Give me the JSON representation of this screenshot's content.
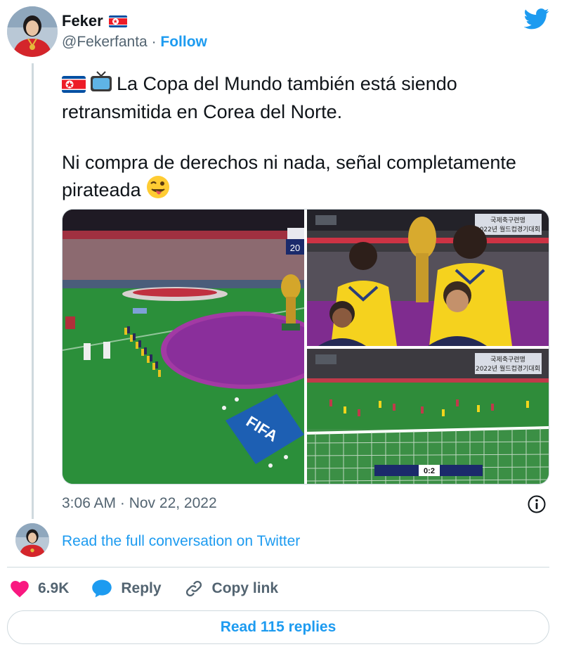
{
  "author": {
    "name": "Feker",
    "handle": "@Fekerfanta",
    "separator": "·",
    "follow_label": "Follow",
    "flag_emoji": "flag-north-korea"
  },
  "tweet": {
    "paragraphs": [
      "La Copa del Mundo también está siendo retransmitida en Corea del Norte.",
      "Ni compra de derechos ni nada, señal completamente pirateada"
    ],
    "leading_emoji": [
      "flag-north-korea",
      "television"
    ],
    "trailing_emoji": "winking-face-with-tongue",
    "timestamp": "3:06 AM · Nov 22, 2022"
  },
  "media": {
    "items": [
      {
        "description_name": "stadium-ceremony-photo",
        "overlay_text": "20"
      },
      {
        "description_name": "anthem-players-photo",
        "overlay_lines": [
          "국제축구련맹",
          "2022년 월드컵경기대회"
        ]
      },
      {
        "description_name": "match-broadcast-photo",
        "overlay_lines": [
          "국제축구련맹",
          "2022년 월드컵경기대회"
        ],
        "score": "0:2",
        "banner_word": "FIFA"
      }
    ]
  },
  "conversation_link": "Read the full conversation on Twitter",
  "actions": {
    "like_count": "6.9K",
    "reply_label": "Reply",
    "copy_label": "Copy link"
  },
  "read_replies_label": "Read 115 replies",
  "colors": {
    "accent": "#1d9bf0",
    "like": "#f91880",
    "text": "#0f1419",
    "secondary": "#536471",
    "border": "#cfd9de"
  }
}
